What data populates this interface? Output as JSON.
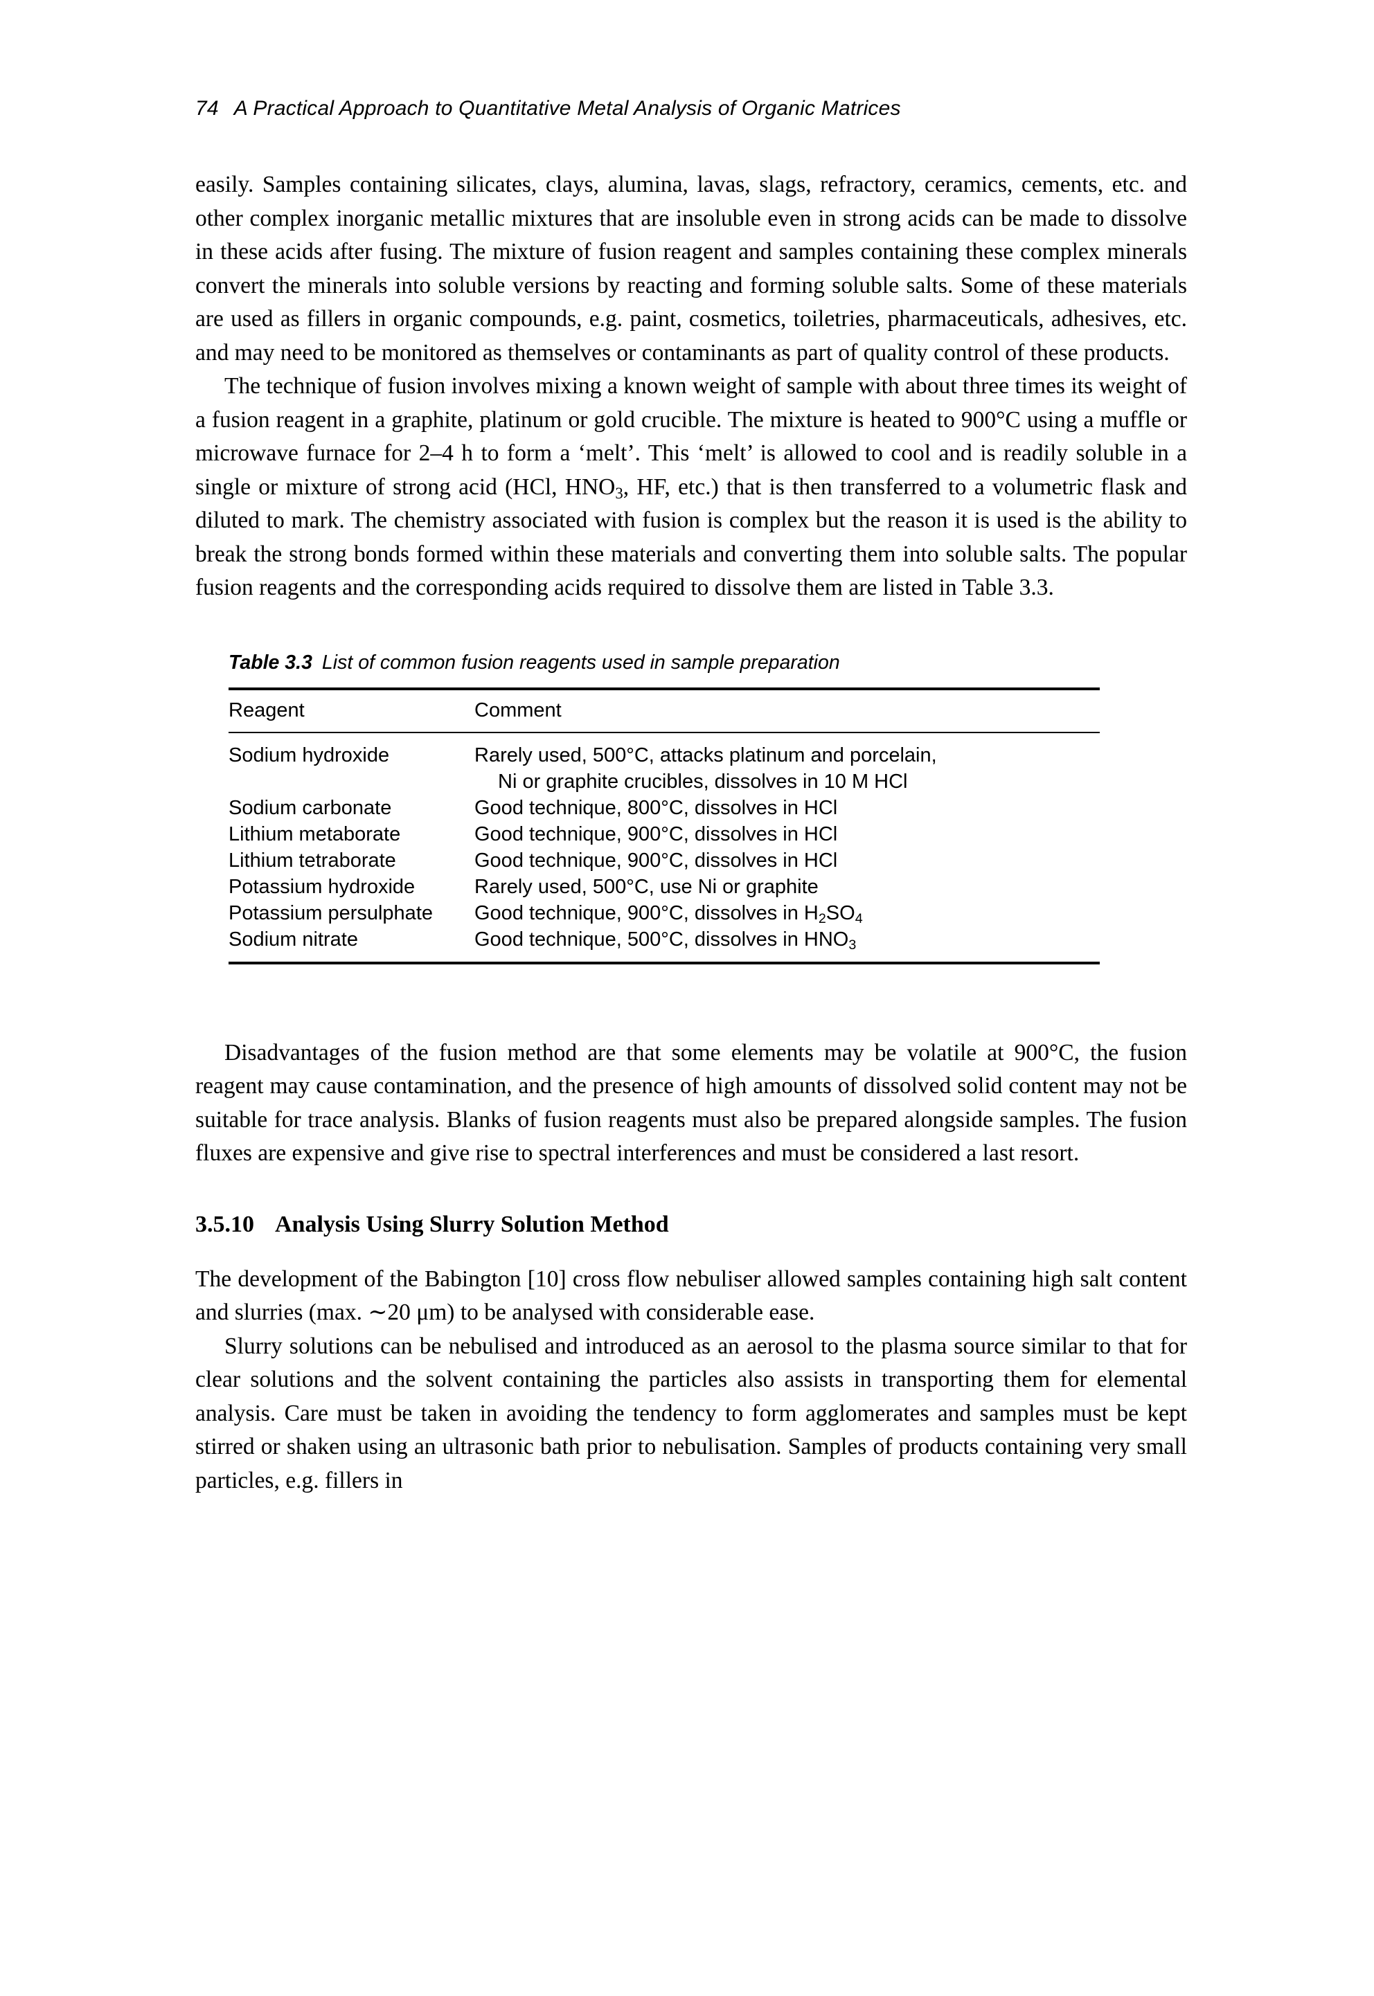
{
  "page": {
    "folio": "74",
    "running_head": "A Practical Approach to Quantitative Metal Analysis of Organic Matrices"
  },
  "paragraphs": {
    "p1": "easily. Samples containing silicates, clays, alumina, lavas, slags, refractory, ceramics, cements, etc. and other complex inorganic metallic mixtures that are insoluble even in strong acids can be made to dissolve in these acids after fusing. The mixture of fusion reagent and samples containing these complex minerals convert the minerals into soluble versions by reacting and forming soluble salts. Some of these materials are used as fillers in organic compounds, e.g. paint, cosmetics, toiletries, pharmaceuticals, adhesives, etc. and may need to be monitored as themselves or contaminants as part of quality control of these products.",
    "p2_a": "The technique of fusion involves mixing a known weight of sample with about three times its weight of a fusion reagent in a graphite, platinum or gold crucible. The mixture is heated to 900°C using a muffle or microwave furnace for 2–4 h to form a ‘melt’. This ‘melt’ is allowed to cool and is readily soluble in a single or mixture of strong acid (HCl, HNO",
    "p2_sub": "3",
    "p2_b": ", HF, etc.) that is then transferred to a volumetric flask and diluted to mark. The chemistry associated with fusion is complex but the reason it is used is the ability to break the strong bonds formed within these materials and converting them into soluble salts. The popular fusion reagents and the corresponding acids required to dissolve them are listed in Table 3.3.",
    "p3": "Disadvantages of the fusion method are that some elements may be volatile at 900°C, the fusion reagent may cause contamination, and the presence of high amounts of dissolved solid content may not be suitable for trace analysis. Blanks of fusion reagents must also be prepared alongside samples. The fusion fluxes are expensive and give rise to spectral interferences and must be considered a last resort.",
    "p4": "The development of the Babington [10] cross flow nebuliser allowed samples containing high salt content and slurries (max. ∼20 μm) to be analysed with considerable ease.",
    "p5": "Slurry solutions can be nebulised and introduced as an aerosol to the plasma source similar to that for clear solutions and the solvent containing the particles also assists in transporting them for elemental analysis. Care must be taken in avoiding the tendency to form agglomerates and samples must be kept stirred or shaken using an ultrasonic bath prior to nebulisation. Samples of products containing very small particles, e.g. fillers in"
  },
  "table": {
    "caption_label": "Table 3.3",
    "caption_text": "List of common fusion reagents used in sample preparation",
    "columns": [
      "Reagent",
      "Comment"
    ],
    "rows": [
      {
        "reagent": "Sodium hydroxide",
        "comment_line1": "Rarely used, 500°C, attacks platinum and porcelain,",
        "comment_line2": "Ni or graphite crucibles, dissolves in 10 M HCl"
      },
      {
        "reagent": "Sodium carbonate",
        "comment_line1": "Good technique, 800°C, dissolves in HCl",
        "comment_line2": ""
      },
      {
        "reagent": "Lithium metaborate",
        "comment_line1": "Good technique, 900°C, dissolves in HCl",
        "comment_line2": ""
      },
      {
        "reagent": "Lithium tetraborate",
        "comment_line1": "Good technique, 900°C, dissolves in HCl",
        "comment_line2": ""
      },
      {
        "reagent": "Potassium hydroxide",
        "comment_line1": "Rarely used, 500°C, use Ni or graphite",
        "comment_line2": ""
      },
      {
        "reagent": "Potassium persulphate",
        "comment_prefix": "Good technique, 900°C, dissolves in H",
        "comment_sub1": "2",
        "comment_mid": "SO",
        "comment_sub2": "4",
        "comment_line2": ""
      },
      {
        "reagent": "Sodium nitrate",
        "comment_prefix": "Good technique, 500°C, dissolves in HNO",
        "comment_sub1": "3",
        "comment_mid": "",
        "comment_sub2": "",
        "comment_line2": ""
      }
    ]
  },
  "section": {
    "number": "3.5.10",
    "title": "Analysis Using Slurry Solution Method"
  }
}
